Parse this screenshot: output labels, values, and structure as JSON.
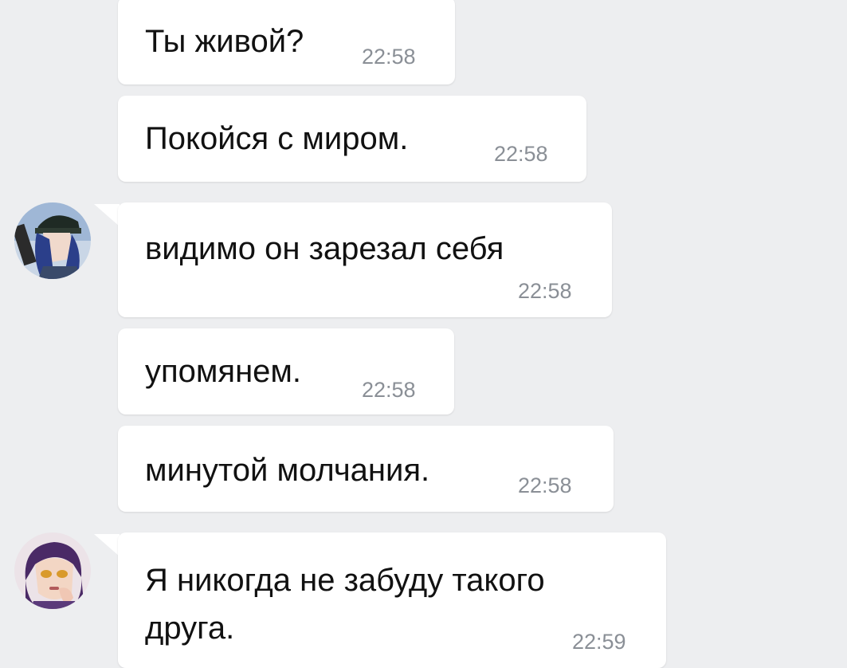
{
  "messages": [
    {
      "text": "Ты живой?",
      "time": "22:58"
    },
    {
      "text": "Покойся с миром.",
      "time": "22:58"
    },
    {
      "text": "видимо он зарезал себя",
      "time": "22:58"
    },
    {
      "text": "упомянем.",
      "time": "22:58"
    },
    {
      "text": "минутой молчания.",
      "time": "22:58"
    },
    {
      "text": "Я никогда не забуду такого друга.",
      "time": "22:59"
    }
  ],
  "colors": {
    "background": "#edeef0",
    "bubble": "#ffffff",
    "text": "#111111",
    "time": "#8a8f96"
  },
  "icons": [
    "avatar-anime-cap-girl",
    "avatar-anime-purple-hair"
  ]
}
